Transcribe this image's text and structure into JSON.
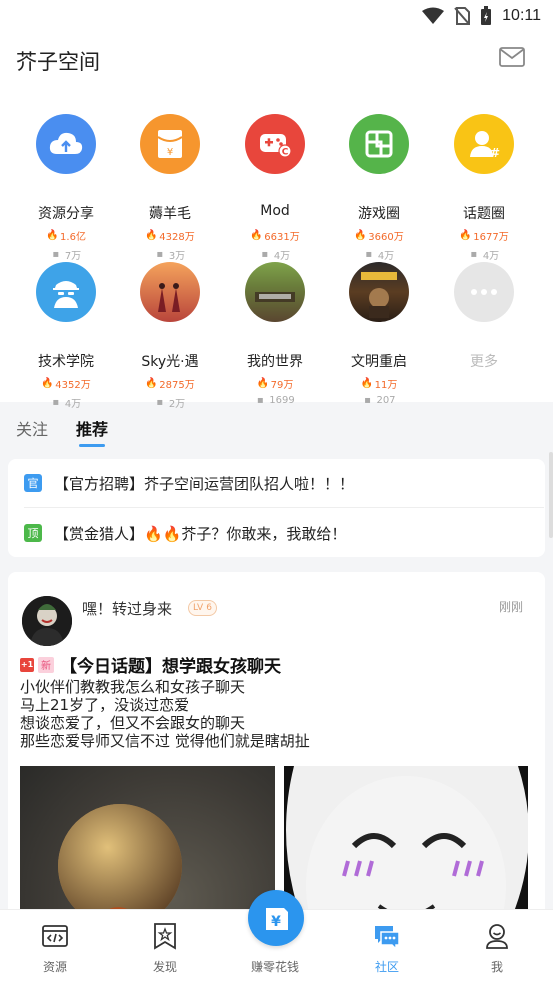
{
  "status_bar": {
    "time": "10:11"
  },
  "header": {
    "title": "芥子空间",
    "mail_icon": "mail-icon"
  },
  "grid": [
    {
      "name": "资源分享",
      "hot": "1.6亿",
      "comments": "7万",
      "icon": "cloud-upload-icon",
      "color": "#4a8ef0"
    },
    {
      "name": "薅羊毛",
      "hot": "4328万",
      "comments": "3万",
      "icon": "red-envelope-icon",
      "color": "#f6962e"
    },
    {
      "name": "Mod",
      "hot": "6631万",
      "comments": "4万",
      "icon": "gamepad-icon",
      "color": "#e8463c"
    },
    {
      "name": "游戏圈",
      "hot": "3660万",
      "comments": "4万",
      "icon": "box-icon",
      "color": "#55b44a"
    },
    {
      "name": "话题圈",
      "hot": "1677万",
      "comments": "4万",
      "icon": "user-topic-icon",
      "color": "#f9c415"
    },
    {
      "name": "技术学院",
      "hot": "4352万",
      "comments": "4万",
      "icon": "spy-icon",
      "color": "#3ea3e8"
    },
    {
      "name": "Sky光·遇",
      "hot": "2875万",
      "comments": "2万",
      "icon": "sky-game-image",
      "color": "#d56a3f"
    },
    {
      "name": "我的世界",
      "hot": "79万",
      "comments": "1699",
      "icon": "minecraft-image",
      "color": "#6b5b3f"
    },
    {
      "name": "文明重启",
      "hot": "11万",
      "comments": "207",
      "icon": "civilization-image",
      "color": "#7a5230"
    },
    {
      "name": "更多",
      "icon": "more-icon",
      "color": "#e6e6e6"
    }
  ],
  "tabs": [
    {
      "label": "关注"
    },
    {
      "label": "推荐"
    }
  ],
  "notices": [
    {
      "badge": "官",
      "badge_color": "#3d9bf0",
      "text": "【官方招聘】芥子空间运营团队招人啦！！！"
    },
    {
      "badge": "顶",
      "badge_color": "#4cb84a",
      "text": "【赏金猎人】🔥🔥芥子？你敢来，我敢给！"
    }
  ],
  "post": {
    "username": "嘿！转过身来",
    "level": "6",
    "time": "刚刚",
    "badge_plus": "+1",
    "badge_new": "新",
    "title": "【今日话题】想学跟女孩聊天",
    "body": [
      "小伙伴们教教我怎么和女孩子聊天",
      "马上21岁了，没谈过恋爱",
      "想谈恋爱了，但又不会跟女的聊天",
      "那些恋爱导师又信不过 觉得他们就是瞎胡扯"
    ]
  },
  "bottom_nav": [
    {
      "label": "资源",
      "icon": "code-file-icon"
    },
    {
      "label": "发现",
      "icon": "bookmark-star-icon"
    },
    {
      "label": "赚零花钱",
      "icon": "money-bag-icon"
    },
    {
      "label": "社区",
      "icon": "chat-bubbles-icon",
      "active": true
    },
    {
      "label": "我",
      "icon": "profile-icon"
    }
  ]
}
